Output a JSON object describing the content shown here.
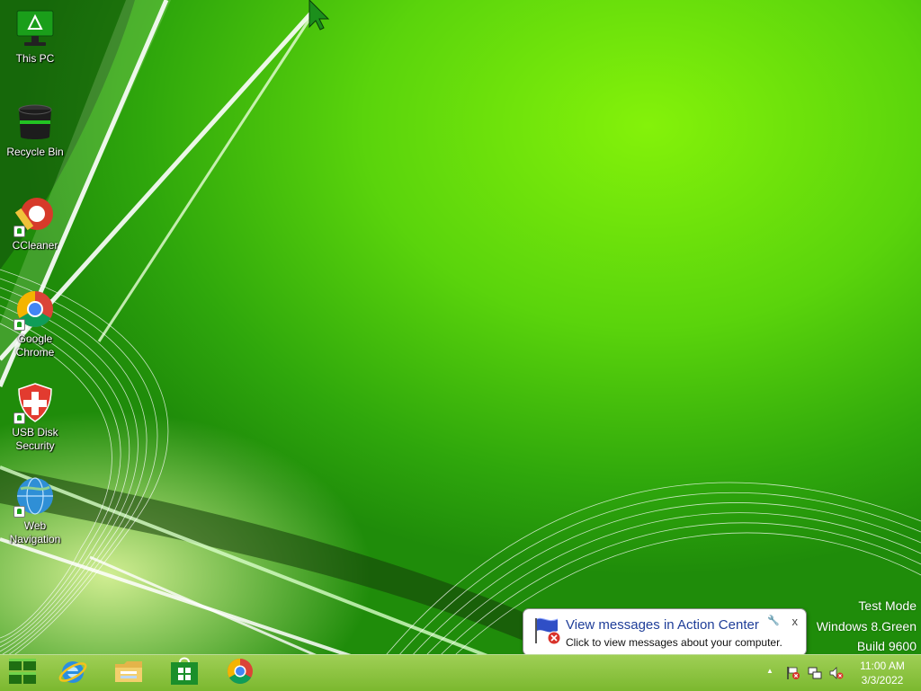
{
  "desktop": {
    "icons": [
      {
        "label": "This PC",
        "icon": "monitor-icon"
      },
      {
        "label": "Recycle Bin",
        "icon": "recycle-bin-icon"
      },
      {
        "label": "CCleaner",
        "icon": "ccleaner-icon"
      },
      {
        "label": "Google Chrome",
        "icon": "chrome-icon"
      },
      {
        "label": "USB Disk Security",
        "icon": "shield-icon"
      },
      {
        "label": "Web Navigation",
        "icon": "globe-icon"
      }
    ]
  },
  "watermark": {
    "line1": "Test Mode",
    "line2": "Windows 8.Green",
    "line3": "Build 9600"
  },
  "balloon": {
    "title": "View messages in Action Center",
    "text": "Click to view messages about your computer.",
    "close": "x"
  },
  "taskbar": {
    "pinned": [
      {
        "name": "start",
        "icon": "windows-logo-icon"
      },
      {
        "name": "internet-explorer",
        "icon": "internet-explorer-icon"
      },
      {
        "name": "file-explorer",
        "icon": "folder-icon"
      },
      {
        "name": "store",
        "icon": "store-icon"
      },
      {
        "name": "chrome",
        "icon": "chrome-icon"
      }
    ],
    "tray": {
      "show_hidden": "▲",
      "time": "11:00 AM",
      "date": "3/3/2022"
    }
  },
  "colors": {
    "wallpaper_green": "#5ad40c",
    "taskbar": "#8cc342",
    "balloon_title": "#1f3e99"
  }
}
